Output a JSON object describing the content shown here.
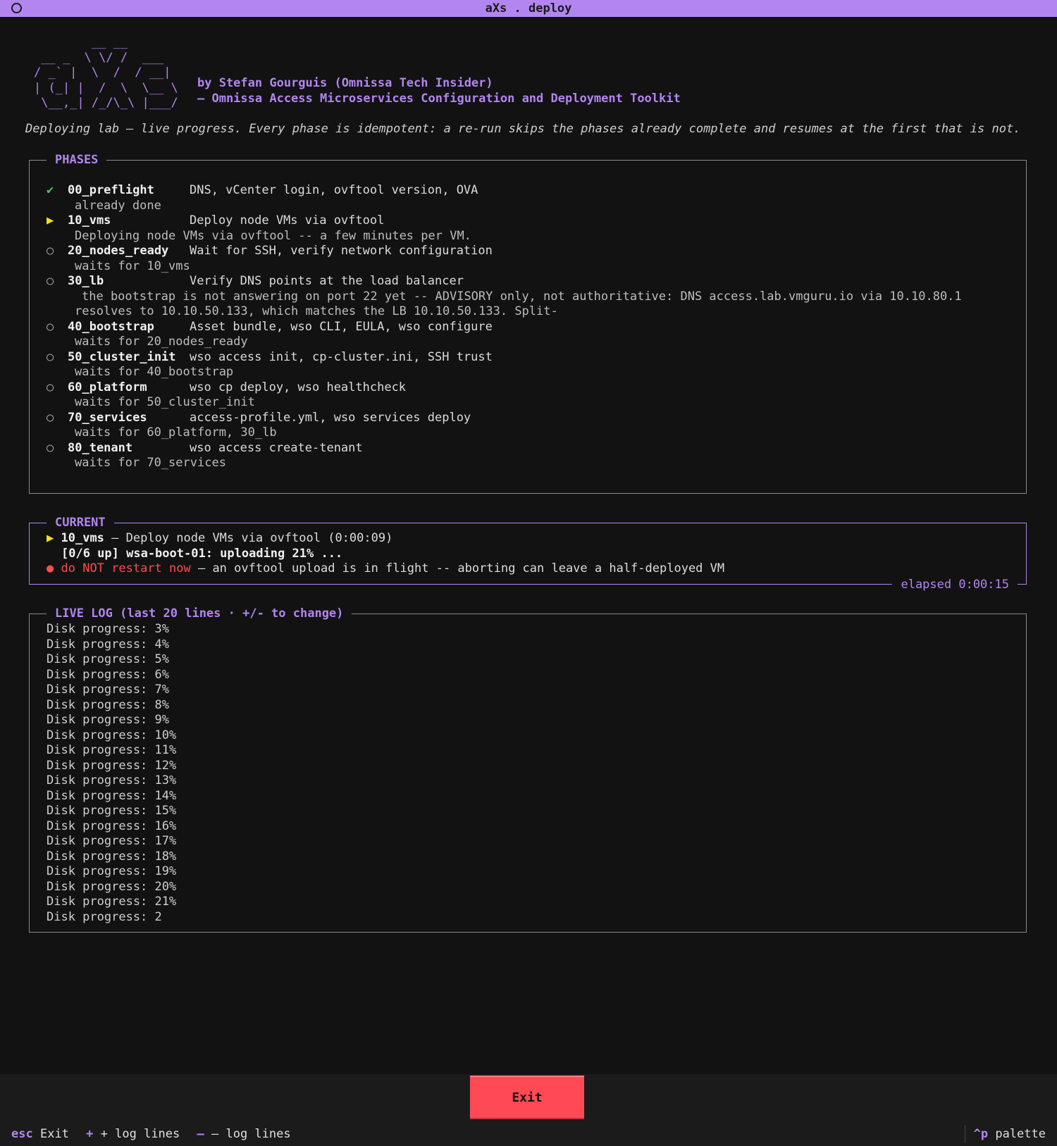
{
  "window": {
    "title": "aXs . deploy"
  },
  "header": {
    "logo_ascii": "        __ __\n __ _  \\ \\/ /  ___\n/ _` |  \\  /  / __|\n| (_| |  /  \\  \\__ \\\n \\__,_| /_/\\_\\ |___/",
    "byline_1": "by Stefan Gourguis (Omnissa Tech Insider)",
    "byline_2": "– Omnissa Access Microservices Configuration and Deployment Toolkit",
    "intro": "Deploying lab – live progress. Every phase is idempotent: a re-run skips the phases already complete and resumes at the first that is not."
  },
  "phases": {
    "title": "PHASES",
    "items": [
      {
        "marker": "✔",
        "status": "done",
        "name": "00_preflight",
        "desc": "DNS, vCenter login, ovftool version, OVA",
        "notes": [
          "already done"
        ]
      },
      {
        "marker": "▶",
        "status": "running",
        "name": "10_vms",
        "desc": "Deploy node VMs via ovftool",
        "notes": [
          "Deploying node VMs via ovftool -- a few minutes per VM."
        ]
      },
      {
        "marker": "○",
        "status": "pending",
        "name": "20_nodes_ready",
        "desc": "Wait for SSH, verify network configuration",
        "notes": [
          "waits for 10_vms"
        ]
      },
      {
        "marker": "○",
        "status": "pending",
        "name": "30_lb",
        "desc": "Verify DNS points at the load balancer",
        "notes": [
          "the bootstrap is not answering on port 22 yet -- ADVISORY only, not authoritative: DNS access.lab.vmguru.io via 10.10.80.1",
          "resolves to 10.10.50.133, which matches the LB 10.10.50.133. Split-"
        ]
      },
      {
        "marker": "○",
        "status": "pending",
        "name": "40_bootstrap",
        "desc": "Asset bundle, wso CLI, EULA, wso configure",
        "notes": [
          "waits for 20_nodes_ready"
        ]
      },
      {
        "marker": "○",
        "status": "pending",
        "name": "50_cluster_init",
        "desc": "wso access init, cp-cluster.ini, SSH trust",
        "notes": [
          "waits for 40_bootstrap"
        ]
      },
      {
        "marker": "○",
        "status": "pending",
        "name": "60_platform",
        "desc": "wso cp deploy, wso healthcheck",
        "notes": [
          "waits for 50_cluster_init"
        ]
      },
      {
        "marker": "○",
        "status": "pending",
        "name": "70_services",
        "desc": "access-profile.yml, wso services deploy",
        "notes": [
          "waits for 60_platform, 30_lb"
        ]
      },
      {
        "marker": "○",
        "status": "pending",
        "name": "80_tenant",
        "desc": "wso access create-tenant",
        "notes": [
          "waits for 70_services"
        ]
      }
    ]
  },
  "current": {
    "title": "CURRENT",
    "marker": "▶",
    "phase": "10_vms",
    "phase_desc": " – Deploy node VMs via ovftool   (0:00:09)",
    "progress": "[0/6 up] wsa-boot-01: uploading 21% ...",
    "warning_marker": "●",
    "warning_red": "do NOT restart now",
    "warning_rest": " – an ovftool upload is in flight -- aborting can leave a half-deployed VM",
    "elapsed": "elapsed 0:00:15"
  },
  "log": {
    "title": "LIVE LOG (last 20 lines · +/- to change)",
    "lines": [
      "Disk progress: 3%",
      "Disk progress: 4%",
      "Disk progress: 5%",
      "Disk progress: 6%",
      "Disk progress: 7%",
      "Disk progress: 8%",
      "Disk progress: 9%",
      "Disk progress: 10%",
      "Disk progress: 11%",
      "Disk progress: 12%",
      "Disk progress: 13%",
      "Disk progress: 14%",
      "Disk progress: 15%",
      "Disk progress: 16%",
      "Disk progress: 17%",
      "Disk progress: 18%",
      "Disk progress: 19%",
      "Disk progress: 20%",
      "Disk progress: 21%",
      "Disk progress: 2"
    ]
  },
  "footer": {
    "exit_button": "Exit",
    "keys": [
      {
        "key": "esc",
        "label": "Exit"
      },
      {
        "key": "+",
        "label": "+ log lines"
      },
      {
        "key": "–",
        "label": "– log lines"
      }
    ],
    "palette_key": "^p",
    "palette_label": "palette"
  },
  "colors": {
    "accent": "#b285f0",
    "done": "#4ec95a",
    "running": "#f2e21d",
    "danger": "#ff4c4c",
    "exit_button": "#ff4a55"
  }
}
